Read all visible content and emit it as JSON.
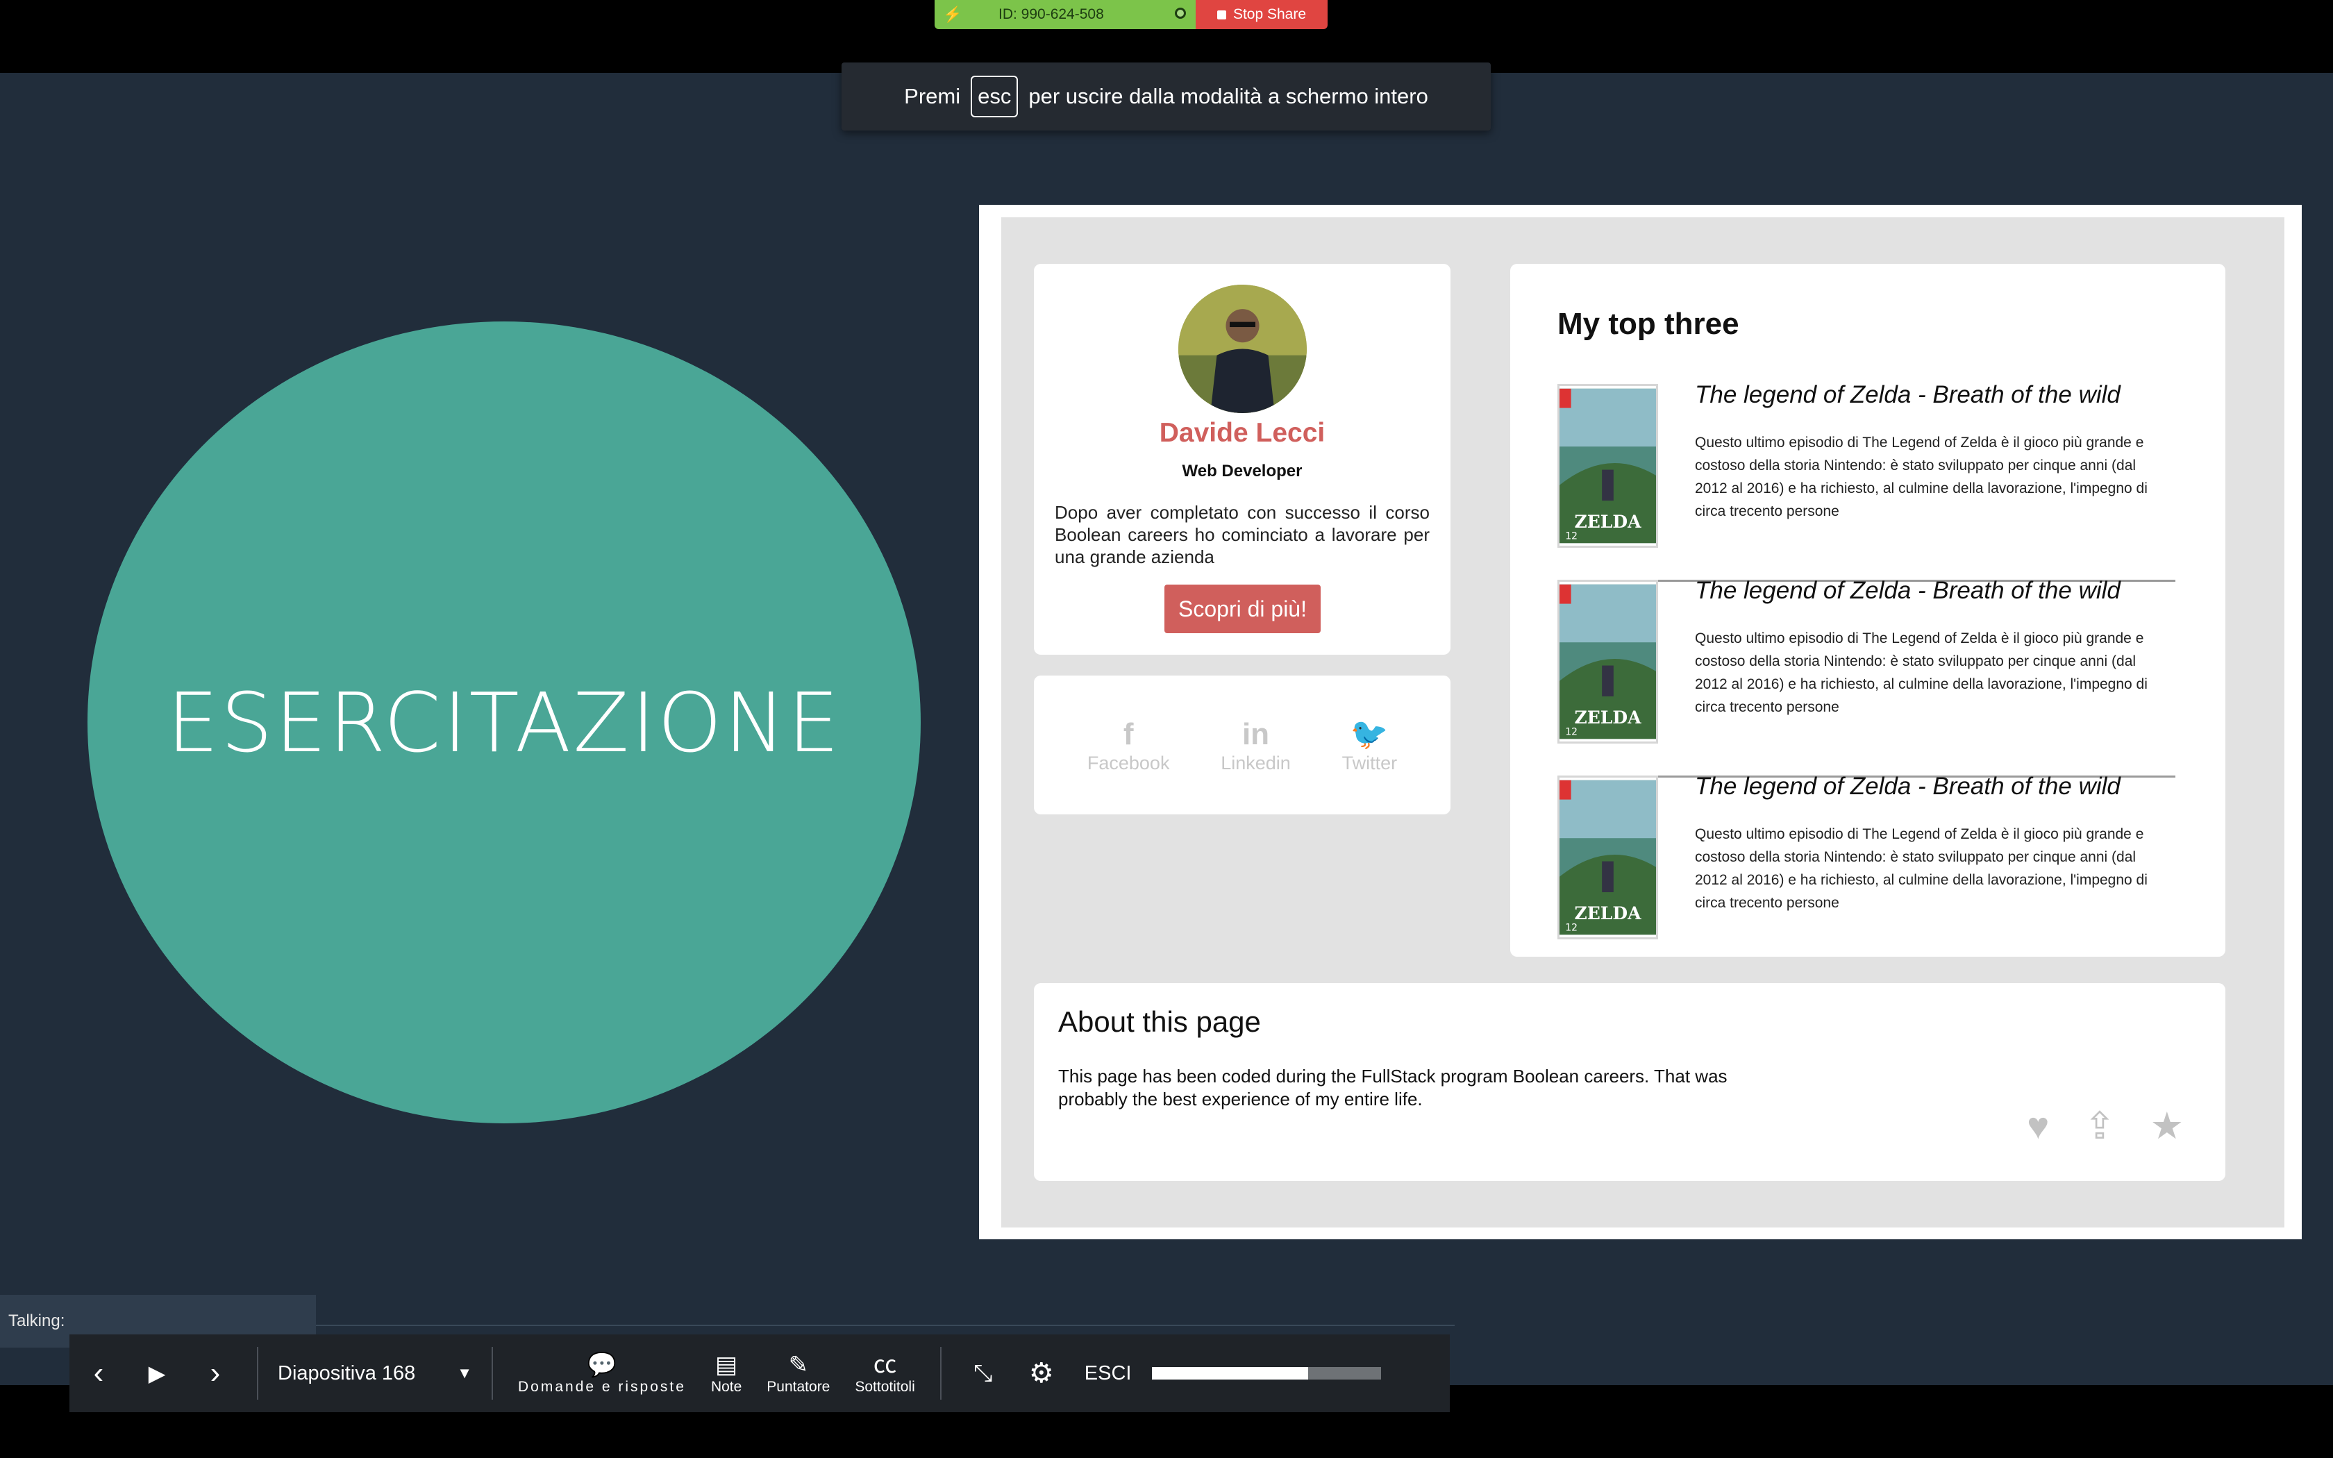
{
  "share_bar": {
    "meeting_id": "ID: 990-624-508",
    "stop_label": "Stop Share"
  },
  "fullscreen_toast": {
    "prefix": "Premi",
    "key": "esc",
    "suffix": "per uscire dalla modalità a schermo intero"
  },
  "slide": {
    "title": "ESERCITAZIONE",
    "profile": {
      "name": "Davide Lecci",
      "role": "Web Developer",
      "description": "Dopo aver completato con successo il corso Boolean careers ho cominciato a lavorare per una grande azienda",
      "button": "Scopri di più!"
    },
    "social": [
      {
        "icon": "facebook-icon",
        "glyph": "f",
        "label": "Facebook"
      },
      {
        "icon": "linkedin-icon",
        "glyph": "in",
        "label": "Linkedin"
      },
      {
        "icon": "twitter-icon",
        "glyph": "🐦",
        "label": "Twitter"
      }
    ],
    "top_three": {
      "title": "My top three",
      "games": [
        {
          "title": "The legend of Zelda - Breath of the wild",
          "description": "Questo ultimo episodio di The Legend of Zelda è il gioco più grande e costoso della storia Nintendo: è stato sviluppato per cinque anni (dal 2012 al 2016) e ha richiesto, al culmine della lavorazione, l'impegno di circa trecento persone"
        },
        {
          "title": "The legend of Zelda - Breath of the wild",
          "description": "Questo ultimo episodio di The Legend of Zelda è il gioco più grande e costoso della storia Nintendo: è stato sviluppato per cinque anni (dal 2012 al 2016) e ha richiesto, al culmine della lavorazione, l'impegno di circa trecento persone"
        },
        {
          "title": "The legend of Zelda - Breath of the wild",
          "description": "Questo ultimo episodio di The Legend of Zelda è il gioco più grande e costoso della storia Nintendo: è stato sviluppato per cinque anni (dal 2012 al 2016) e ha richiesto, al culmine della lavorazione, l'impegno di circa trecento persone"
        }
      ],
      "cover_text": "ZELDA",
      "cover_rating": "12"
    },
    "about": {
      "title": "About this page",
      "text": "This page has been coded during the FullStack program Boolean careers. That was probably the best experience of my entire life."
    }
  },
  "talking": {
    "label": "Talking:"
  },
  "toolbar": {
    "slide_label": "Diapositiva 168",
    "qa_label": "Domande e risposte",
    "notes_label": "Note",
    "pointer_label": "Puntatore",
    "captions_label": "Sottotitoli",
    "exit_label": "ESCI",
    "progress": 0.68
  },
  "colors": {
    "accent": "#d05f5c",
    "circle": "#4aa696",
    "background": "#212d3b",
    "share_green": "#7cc44a",
    "share_red": "#e04541"
  }
}
